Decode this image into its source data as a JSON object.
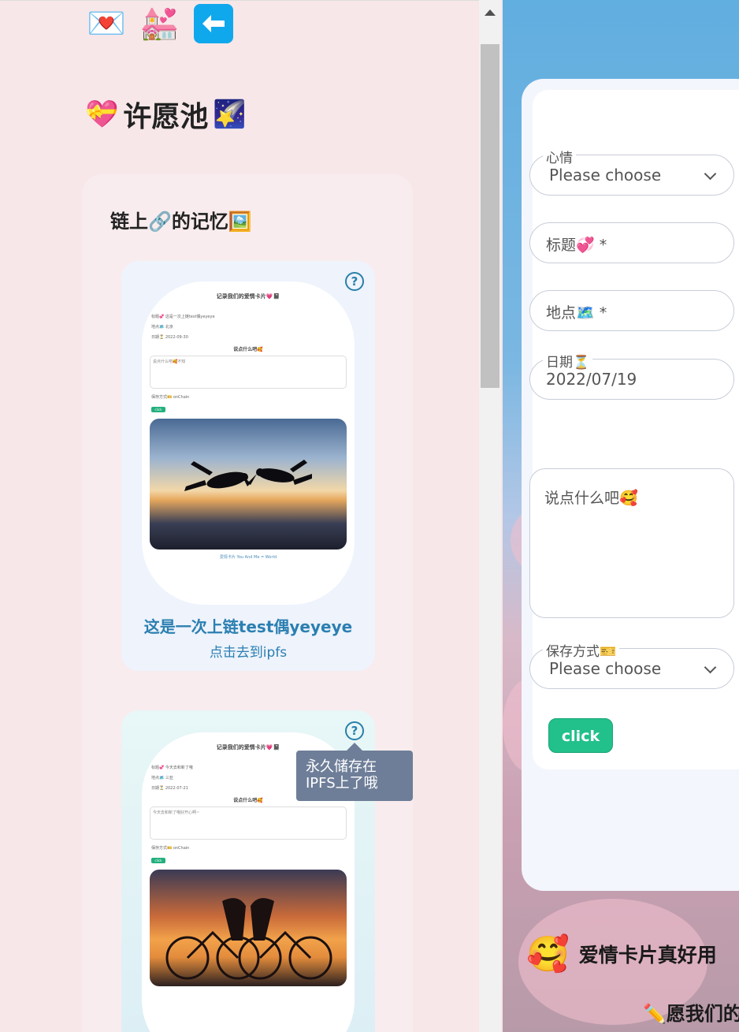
{
  "left": {
    "icons": {
      "letter": "💌",
      "church": "💒",
      "back": "back-arrow"
    },
    "title_prefix_emoji": "💝",
    "title": "许愿池",
    "title_suffix_emoji": "🌠",
    "memory": {
      "title": "链上🔗的记忆🖼️",
      "cards": [
        {
          "title": "这是一次上链test偶yeyeye",
          "link": "点击去到ipfs",
          "preview": {
            "heading": "记录我们的爱情卡片💗📓",
            "fields": [
              "标题💞 这是一次上链test偶yeyeye",
              "地点🗺️ 北京",
              "日期⏳ 2022-09-30"
            ],
            "sub": "说点什么吧🥰",
            "text": "说点什么吧🥰不知",
            "save": "保存方式🎫 onChain",
            "btn": "click",
            "foot": "爱情卡片 You And Me = World"
          }
        },
        {
          "preview": {
            "heading": "记录我们的爱情卡片💗📓",
            "fields": [
              "标题💞 今天去和新了哦",
              "地点🗺️ 三亚",
              "日期⏳ 2022-07-21"
            ],
            "sub": "说点什么吧🥰",
            "text": "今天去和新了哦好开心啊~",
            "save": "保存方式🎫 onChain",
            "btn": "click"
          }
        }
      ]
    },
    "tooltip": "永久储存在IPFS上了哦"
  },
  "form": {
    "mood": {
      "label": "心情",
      "value": "Please choose"
    },
    "title_field": {
      "placeholder": "标题💞 *"
    },
    "location": {
      "placeholder": "地点🗺️ *"
    },
    "date": {
      "label": "日期⏳",
      "value": "2022/07/19"
    },
    "message": {
      "placeholder": "说点什么吧🥰"
    },
    "save_mode": {
      "label": "保存方式🎫",
      "value": "Please choose"
    },
    "submit": "click"
  },
  "footer": {
    "emoji": "🥰",
    "title": "爱情卡片真好用",
    "wish": "✏️愿我们的"
  }
}
